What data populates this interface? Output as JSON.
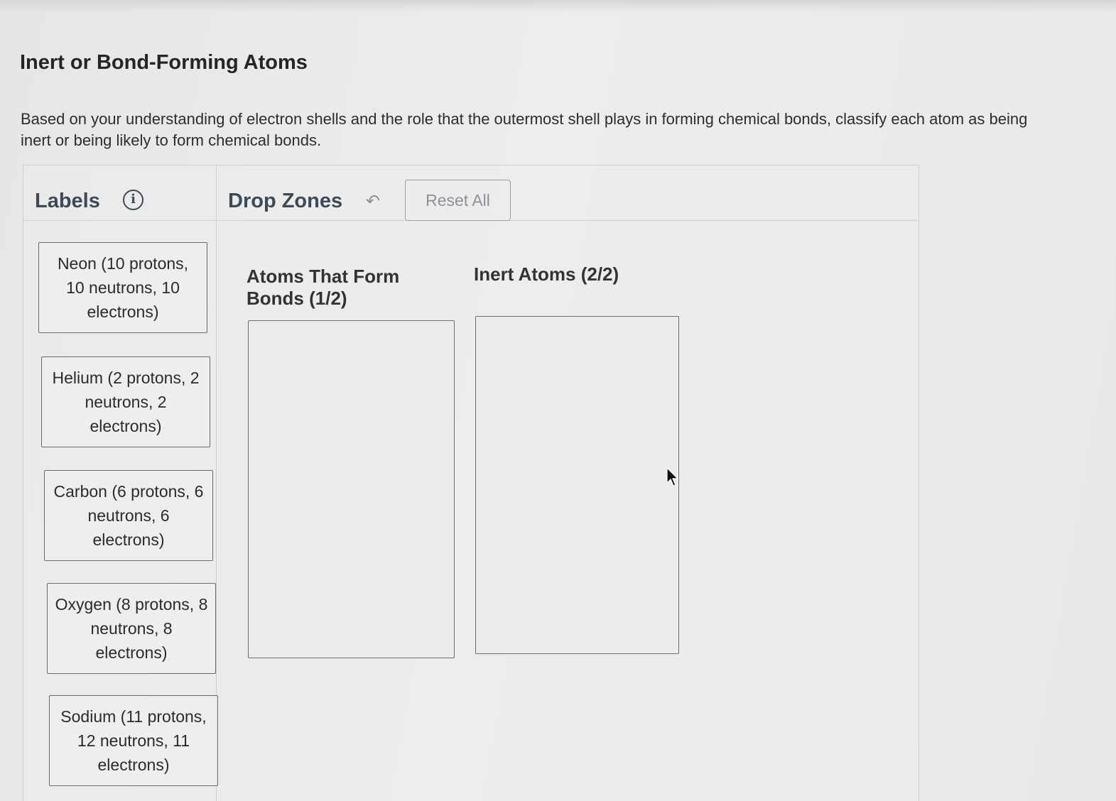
{
  "title": "Inert or Bond-Forming Atoms",
  "instructions": "Based on your understanding of electron shells and the role that the outermost shell plays in forming chemical bonds, classify each atom as being inert or being likely to form chemical bonds.",
  "labels_panel": {
    "heading": "Labels",
    "info_icon": "info-icon",
    "items": [
      "Neon (10 protons, 10 neutrons, 10 electrons)",
      "Helium (2 protons, 2 neutrons, 2 electrons)",
      "Carbon (6 protons, 6 neutrons, 6 electrons)",
      "Oxygen (8 protons, 8 neutrons, 8 electrons)",
      "Sodium (11 protons, 12 neutrons, 11 electrons)"
    ]
  },
  "drop_zones_panel": {
    "heading": "Drop Zones",
    "undo_icon": "undo-icon",
    "reset_label": "Reset All",
    "zones": [
      {
        "title": "Atoms That Form Bonds (1/2)"
      },
      {
        "title": "Inert Atoms (2/2)"
      }
    ]
  },
  "colors": {
    "background": "#e9e9ea",
    "heading_text": "#3e4a54",
    "border": "#6e6e6e"
  }
}
